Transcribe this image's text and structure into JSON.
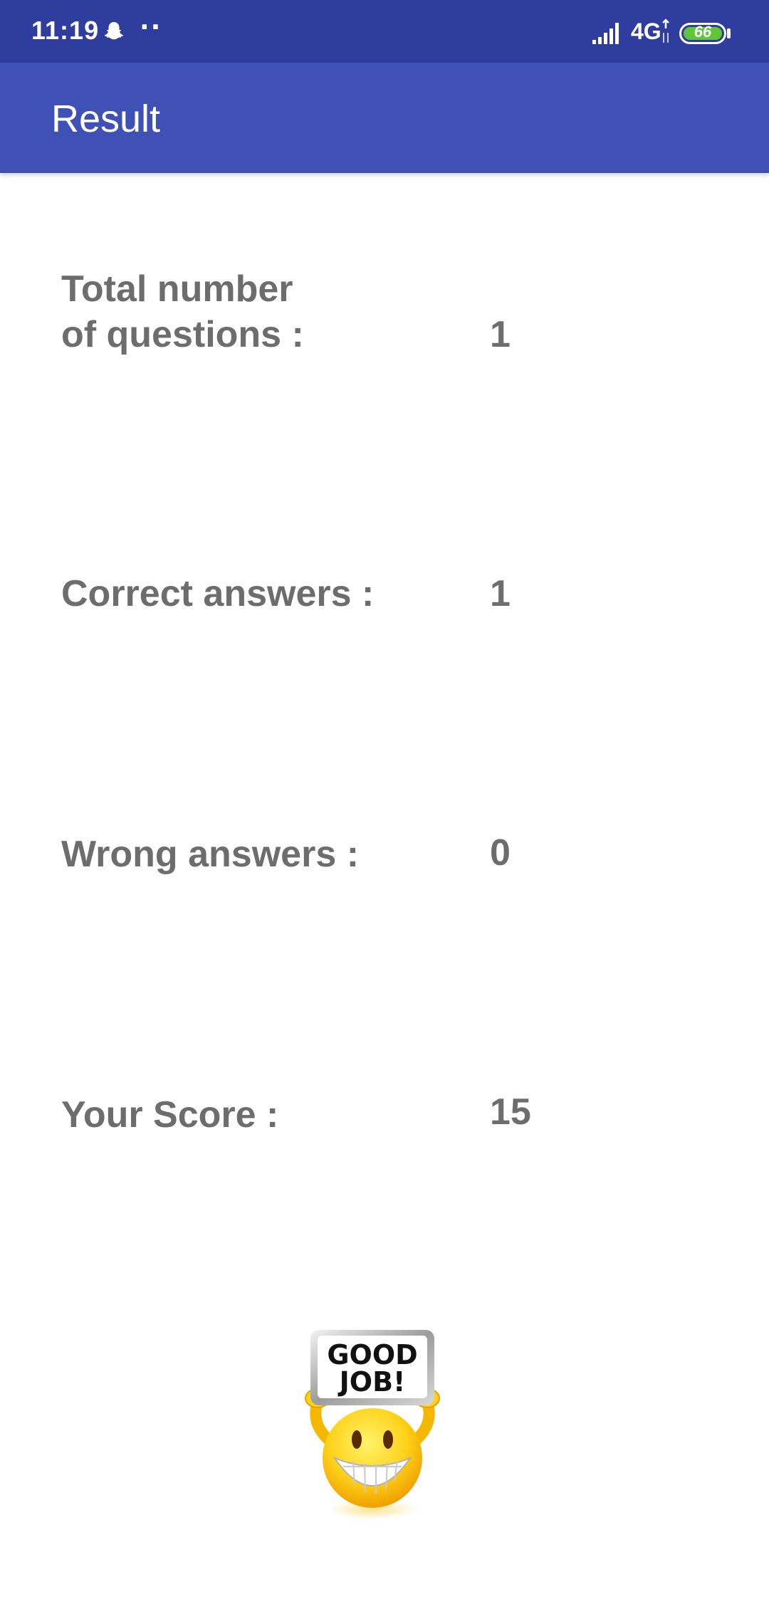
{
  "status_bar": {
    "time": "11:19",
    "notification_icon": "snapchat-ghost-icon",
    "more_indicator": "··",
    "signal_icon": "cell-signal-icon",
    "network": "4G",
    "battery_level": "66",
    "battery_color": "#5fc638"
  },
  "app_bar": {
    "title": "Result",
    "color": "#3f51b5"
  },
  "results": {
    "total": {
      "label": "Total number\n of questions :",
      "value": "1"
    },
    "correct": {
      "label": "Correct answers :",
      "value": "1"
    },
    "wrong": {
      "label": "Wrong answers :",
      "value": "0"
    },
    "score": {
      "label": "Your Score :",
      "value": "15"
    }
  },
  "image": {
    "icon": "good-job-smiley-icon",
    "sign_line1": "GOOD",
    "sign_line2": "JOB!"
  },
  "colors": {
    "status_bar": "#2f3e9e",
    "text": "#6d6d6d",
    "background": "#ffffff"
  }
}
